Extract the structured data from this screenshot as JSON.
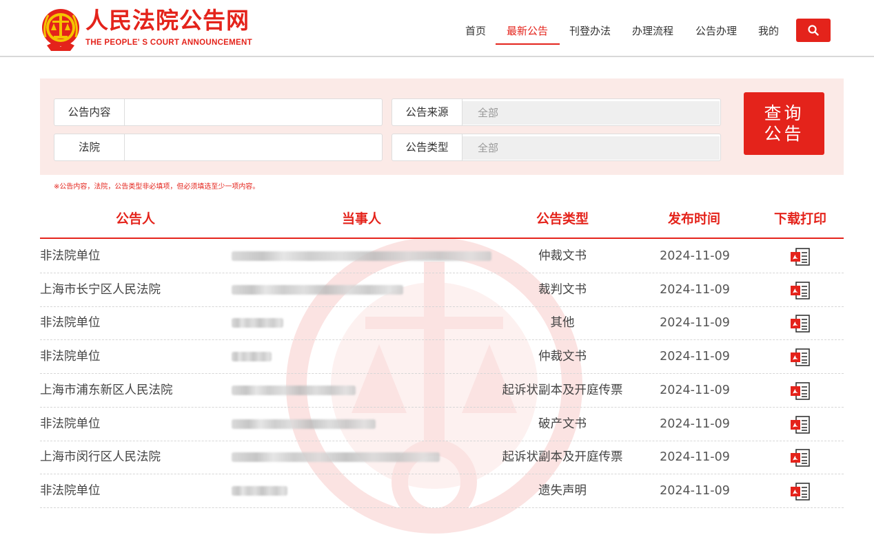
{
  "brand": {
    "title": "人民法院公告网",
    "subtitle": "THE PEOPLE' S COURT ANNOUNCEMENT",
    "color": "#e4231b"
  },
  "nav": {
    "items": [
      {
        "label": "首页"
      },
      {
        "label": "最新公告",
        "active": true
      },
      {
        "label": "刊登办法"
      },
      {
        "label": "办理流程"
      },
      {
        "label": "公告办理"
      },
      {
        "label": "我的"
      }
    ],
    "search_icon": "search-icon"
  },
  "search": {
    "content_label": "公告内容",
    "content_value": "",
    "court_label": "法院",
    "court_value": "",
    "source_label": "公告来源",
    "source_value": "全部",
    "type_label": "公告类型",
    "type_value": "全部",
    "query_line1": "查询",
    "query_line2": "公告",
    "note": "※公告内容，法院，公告类型非必填项，但必须填选至少一项内容。"
  },
  "table": {
    "headers": {
      "publisher": "公告人",
      "party": "当事人",
      "type": "公告类型",
      "date": "发布时间",
      "download": "下载打印"
    },
    "rows": [
      {
        "publisher": "非法院单位",
        "type": "仲裁文书",
        "date": "2024-11-09",
        "blur": 0.65
      },
      {
        "publisher": "上海市长宁区人民法院",
        "type": "裁判文书",
        "date": "2024-11-09",
        "blur": 0.43
      },
      {
        "publisher": "非法院单位",
        "type": "其他",
        "date": "2024-11-09",
        "blur": 0.13
      },
      {
        "publisher": "非法院单位",
        "type": "仲裁文书",
        "date": "2024-11-09",
        "blur": 0.1
      },
      {
        "publisher": "上海市浦东新区人民法院",
        "type": "起诉状副本及开庭传票",
        "date": "2024-11-09",
        "blur": 0.31
      },
      {
        "publisher": "非法院单位",
        "type": "破产文书",
        "date": "2024-11-09",
        "blur": 0.36
      },
      {
        "publisher": "上海市闵行区人民法院",
        "type": "起诉状副本及开庭传票",
        "date": "2024-11-09",
        "blur": 0.52
      },
      {
        "publisher": "非法院单位",
        "type": "遗失声明",
        "date": "2024-11-09",
        "blur": 0.14
      }
    ],
    "download_icon": "pdf-icon"
  }
}
